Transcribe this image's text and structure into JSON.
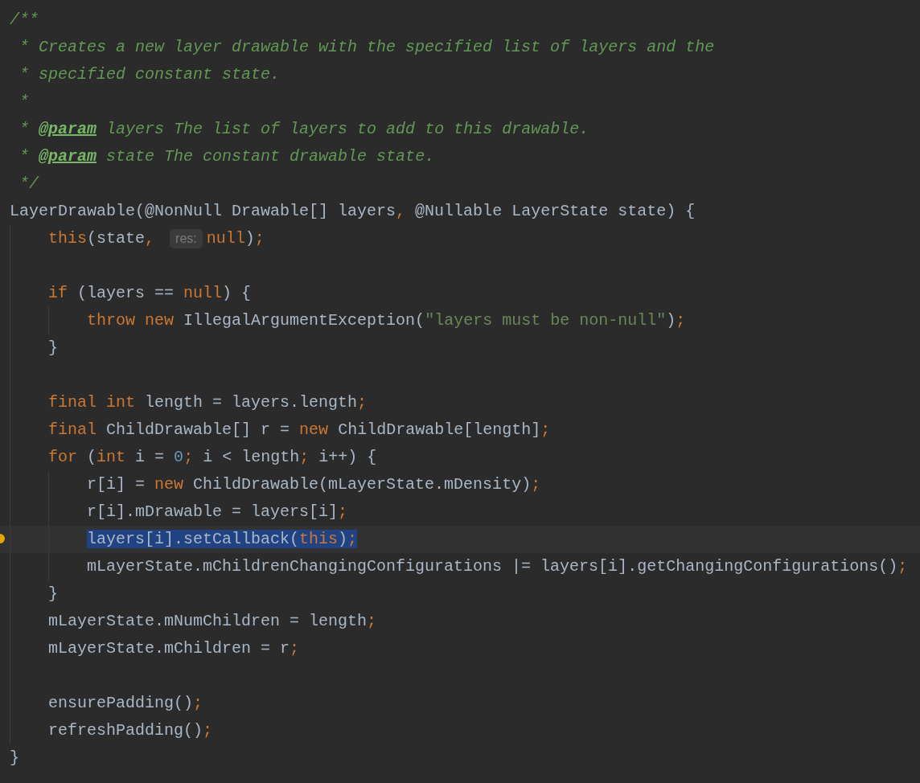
{
  "editor": {
    "lines": [
      {
        "current": false,
        "tokens": [
          {
            "text": "/**",
            "kind": "comment"
          }
        ]
      },
      {
        "current": false,
        "tokens": [
          {
            "text": " * Creates a new layer drawable with the specified list of layers and the",
            "kind": "comment"
          }
        ]
      },
      {
        "current": false,
        "tokens": [
          {
            "text": " * specified constant state.",
            "kind": "comment"
          }
        ]
      },
      {
        "current": false,
        "tokens": [
          {
            "text": " *",
            "kind": "comment"
          }
        ]
      },
      {
        "current": false,
        "tokens": [
          {
            "text": " * ",
            "kind": "comment"
          },
          {
            "text": "@param",
            "kind": "doc_tag"
          },
          {
            "text": " layers The list of layers to add to this drawable.",
            "kind": "comment"
          }
        ]
      },
      {
        "current": false,
        "tokens": [
          {
            "text": " * ",
            "kind": "comment"
          },
          {
            "text": "@param",
            "kind": "doc_tag"
          },
          {
            "text": " state The constant drawable state.",
            "kind": "comment"
          }
        ]
      },
      {
        "current": false,
        "tokens": [
          {
            "text": " */",
            "kind": "comment"
          }
        ]
      },
      {
        "current": false,
        "tokens": [
          {
            "text": "LayerDrawable(@NonNull Drawable[] layers",
            "kind": "plain"
          },
          {
            "text": ",",
            "kind": "keyword"
          },
          {
            "text": " @Nullable LayerState state) {",
            "kind": "plain"
          }
        ]
      },
      {
        "current": false,
        "tokens": [
          {
            "text": "    this",
            "kind": "keyword"
          },
          {
            "text": "(state",
            "kind": "plain"
          },
          {
            "text": ", ",
            "kind": "keyword"
          },
          {
            "text": "res:",
            "kind": "hint"
          },
          {
            "text": "null",
            "kind": "keyword"
          },
          {
            "text": ")",
            "kind": "plain"
          },
          {
            "text": ";",
            "kind": "keyword"
          }
        ]
      },
      {
        "current": false
      },
      {
        "current": false,
        "tokens": [
          {
            "text": "    if",
            "kind": "keyword"
          },
          {
            "text": " (layers == ",
            "kind": "plain"
          },
          {
            "text": "null",
            "kind": "keyword"
          },
          {
            "text": ") {",
            "kind": "plain"
          }
        ]
      },
      {
        "current": false,
        "tokens": [
          {
            "text": "        throw new",
            "kind": "keyword"
          },
          {
            "text": " IllegalArgumentException(",
            "kind": "plain"
          },
          {
            "text": "\"layers must be non-null\"",
            "kind": "string"
          },
          {
            "text": ")",
            "kind": "plain"
          },
          {
            "text": ";",
            "kind": "keyword"
          }
        ]
      },
      {
        "current": false,
        "tokens": [
          {
            "text": "    }",
            "kind": "plain"
          }
        ]
      },
      {
        "current": false
      },
      {
        "current": false,
        "tokens": [
          {
            "text": "    final int",
            "kind": "keyword"
          },
          {
            "text": " length = layers.length",
            "kind": "plain"
          },
          {
            "text": ";",
            "kind": "keyword"
          }
        ]
      },
      {
        "current": false,
        "tokens": [
          {
            "text": "    final",
            "kind": "keyword"
          },
          {
            "text": " ChildDrawable[] r = ",
            "kind": "plain"
          },
          {
            "text": "new",
            "kind": "keyword"
          },
          {
            "text": " ChildDrawable[length]",
            "kind": "plain"
          },
          {
            "text": ";",
            "kind": "keyword"
          }
        ]
      },
      {
        "current": false,
        "tokens": [
          {
            "text": "    for",
            "kind": "keyword"
          },
          {
            "text": " (",
            "kind": "plain"
          },
          {
            "text": "int",
            "kind": "keyword"
          },
          {
            "text": " i = ",
            "kind": "plain"
          },
          {
            "text": "0",
            "kind": "number"
          },
          {
            "text": ";",
            "kind": "keyword"
          },
          {
            "text": " i < length",
            "kind": "plain"
          },
          {
            "text": ";",
            "kind": "keyword"
          },
          {
            "text": " i++) {",
            "kind": "plain"
          }
        ]
      },
      {
        "current": false,
        "tokens": [
          {
            "text": "        r[i] = ",
            "kind": "plain"
          },
          {
            "text": "new",
            "kind": "keyword"
          },
          {
            "text": " ChildDrawable(mLayerState.mDensity)",
            "kind": "plain"
          },
          {
            "text": ";",
            "kind": "keyword"
          }
        ]
      },
      {
        "current": false,
        "tokens": [
          {
            "text": "        r[i].mDrawable = layers[i]",
            "kind": "plain"
          },
          {
            "text": ";",
            "kind": "keyword"
          }
        ]
      },
      {
        "current": true,
        "tokens": [
          {
            "text": "        layers[i].setCallback(",
            "kind": "plain",
            "selected": true
          },
          {
            "text": "this",
            "kind": "keyword",
            "selected": true
          },
          {
            "text": ")",
            "kind": "plain",
            "selected": true
          },
          {
            "text": ";",
            "kind": "keyword",
            "selected": true
          }
        ]
      },
      {
        "current": false,
        "tokens": [
          {
            "text": "        mLayerState.mChildrenChangingConfigurations |= layers[i].getChangingConfigurations()",
            "kind": "plain"
          },
          {
            "text": ";",
            "kind": "keyword"
          }
        ]
      },
      {
        "current": false,
        "tokens": [
          {
            "text": "    }",
            "kind": "plain"
          }
        ]
      },
      {
        "current": false,
        "tokens": [
          {
            "text": "    mLayerState.mNumChildren = length",
            "kind": "plain"
          },
          {
            "text": ";",
            "kind": "keyword"
          }
        ]
      },
      {
        "current": false,
        "tokens": [
          {
            "text": "    mLayerState.mChildren = r",
            "kind": "plain"
          },
          {
            "text": ";",
            "kind": "keyword"
          }
        ]
      },
      {
        "current": false
      },
      {
        "current": false,
        "tokens": [
          {
            "text": "    ensurePadding()",
            "kind": "plain"
          },
          {
            "text": ";",
            "kind": "keyword"
          }
        ]
      },
      {
        "current": false,
        "tokens": [
          {
            "text": "    refreshPadding()",
            "kind": "plain"
          },
          {
            "text": ";",
            "kind": "keyword"
          }
        ]
      },
      {
        "current": false,
        "tokens": [
          {
            "text": "}",
            "kind": "plain"
          }
        ]
      }
    ]
  }
}
